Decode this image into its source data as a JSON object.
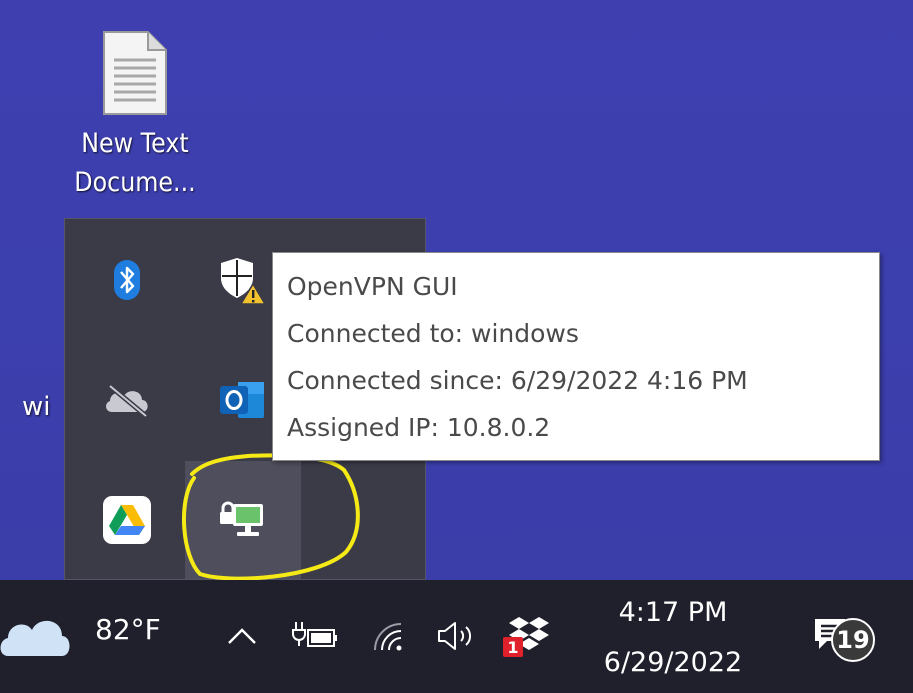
{
  "desktop": {
    "icon_label": "New Text\nDocume...",
    "partial_label": "wi"
  },
  "tray_flyout": {
    "icons": [
      "bluetooth-icon",
      "windows-security-warning-icon",
      "onedrive-offline-icon",
      "outlook-icon",
      "google-drive-icon",
      "openvpn-gui-icon"
    ],
    "highlight_color": "#f5ea16"
  },
  "tooltip": {
    "title": "OpenVPN GUI",
    "connected_to": "Connected to: windows",
    "connected_since": "Connected since: 6/29/2022 4:16 PM",
    "assigned_ip": "Assigned IP: 10.8.0.2"
  },
  "taskbar": {
    "weather_temp": "82°F",
    "clock_time": "4:17 PM",
    "clock_date": "6/29/2022",
    "notification_count": "19",
    "dropbox_badge": "1"
  },
  "colors": {
    "desktop_background": "#3f3fb0",
    "taskbar_background": "#20202c",
    "flyout_background": "#3b3b48",
    "openvpn_green": "#6ac26a",
    "warning_yellow": "#f2c12e"
  }
}
